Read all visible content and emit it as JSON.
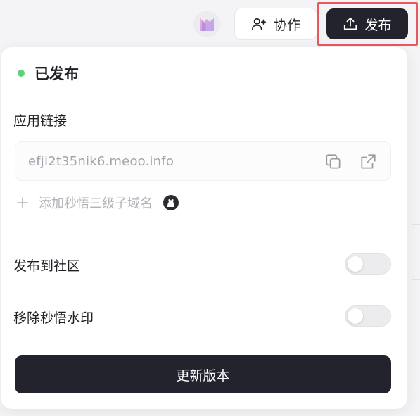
{
  "header": {
    "collaborate_label": "协作",
    "publish_label": "发布"
  },
  "panel": {
    "status_text": "已发布",
    "status_color": "#5fd17a",
    "app_link_label": "应用链接",
    "app_link_url": "efji2t35nik6.meoo.info",
    "add_domain_label": "添加秒悟三级子域名",
    "publish_community_label": "发布到社区",
    "publish_community_enabled": false,
    "remove_watermark_label": "移除秒悟水印",
    "remove_watermark_enabled": false,
    "update_button_label": "更新版本"
  },
  "colors": {
    "primary_dark": "#22232c",
    "highlight": "#e8585e"
  },
  "icons": [
    "avatar-icon",
    "add-user-icon",
    "upload-icon",
    "copy-icon",
    "external-link-icon",
    "plus-icon",
    "github-icon"
  ]
}
